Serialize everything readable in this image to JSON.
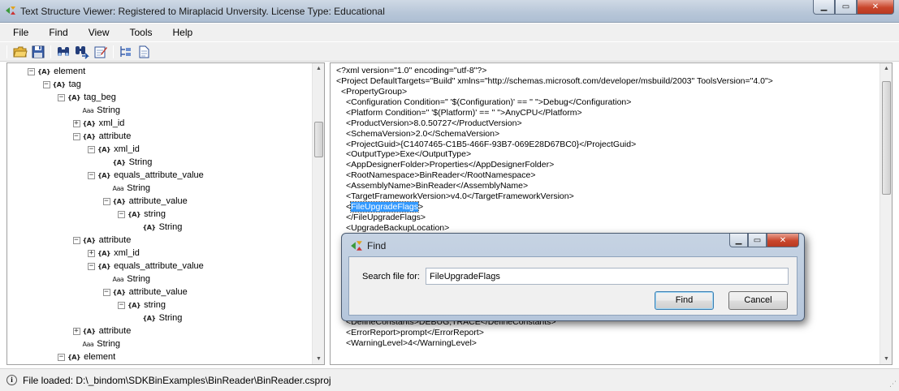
{
  "window": {
    "title": "Text Structure Viewer: Registered to Miraplacid Unversity. License Type: Educational",
    "minimize_glyph": "▁",
    "maximize_glyph": "▭",
    "close_glyph": "✕"
  },
  "menu": [
    "File",
    "Find",
    "View",
    "Tools",
    "Help"
  ],
  "toolbar": {
    "icons": [
      "open-folder-icon",
      "save-icon",
      "find-icon",
      "find-next-icon",
      "edit-icon",
      "tree-view-icon",
      "document-view-icon"
    ]
  },
  "tree": {
    "icon_labels": {
      "element": "{A}",
      "string": "Aaa"
    },
    "nodes": [
      {
        "label": "element",
        "level": 0,
        "toggle": "−",
        "kind": "element"
      },
      {
        "label": "tag",
        "level": 1,
        "toggle": "−",
        "kind": "element"
      },
      {
        "label": "tag_beg",
        "level": 2,
        "toggle": "−",
        "kind": "element"
      },
      {
        "label": "String",
        "level": 3,
        "toggle": "",
        "kind": "string"
      },
      {
        "label": "xml_id",
        "level": 3,
        "toggle": "+",
        "kind": "element"
      },
      {
        "label": "attribute",
        "level": 3,
        "toggle": "−",
        "kind": "element"
      },
      {
        "label": "xml_id",
        "level": 4,
        "toggle": "−",
        "kind": "element"
      },
      {
        "label": "String",
        "level": 5,
        "toggle": "",
        "kind": "element"
      },
      {
        "label": "equals_attribute_value",
        "level": 4,
        "toggle": "−",
        "kind": "element"
      },
      {
        "label": "String",
        "level": 5,
        "toggle": "",
        "kind": "string"
      },
      {
        "label": "attribute_value",
        "level": 5,
        "toggle": "−",
        "kind": "element"
      },
      {
        "label": "string",
        "level": 6,
        "toggle": "−",
        "kind": "element"
      },
      {
        "label": "String",
        "level": 7,
        "toggle": "",
        "kind": "element"
      },
      {
        "label": "attribute",
        "level": 3,
        "toggle": "−",
        "kind": "element"
      },
      {
        "label": "xml_id",
        "level": 4,
        "toggle": "+",
        "kind": "element"
      },
      {
        "label": "equals_attribute_value",
        "level": 4,
        "toggle": "−",
        "kind": "element"
      },
      {
        "label": "String",
        "level": 5,
        "toggle": "",
        "kind": "string"
      },
      {
        "label": "attribute_value",
        "level": 5,
        "toggle": "−",
        "kind": "element"
      },
      {
        "label": "string",
        "level": 6,
        "toggle": "−",
        "kind": "element"
      },
      {
        "label": "String",
        "level": 7,
        "toggle": "",
        "kind": "element"
      },
      {
        "label": "attribute",
        "level": 3,
        "toggle": "+",
        "kind": "element"
      },
      {
        "label": "String",
        "level": 3,
        "toggle": "",
        "kind": "string"
      },
      {
        "label": "element",
        "level": 2,
        "toggle": "−",
        "kind": "element"
      }
    ]
  },
  "xml": {
    "lines": [
      {
        "text": "<?xml version=\"1.0\" encoding=\"utf-8\"?>",
        "indent": 0
      },
      {
        "text": "<Project DefaultTargets=\"Build\" xmlns=\"http://schemas.microsoft.com/developer/msbuild/2003\" ToolsVersion=\"4.0\">",
        "indent": 0
      },
      {
        "text": "<PropertyGroup>",
        "indent": 1
      },
      {
        "text": "<Configuration Condition=\" '$(Configuration)' == '' \">Debug</Configuration>",
        "indent": 2
      },
      {
        "text": "<Platform Condition=\" '$(Platform)' == '' \">AnyCPU</Platform>",
        "indent": 2
      },
      {
        "text": "<ProductVersion>8.0.50727</ProductVersion>",
        "indent": 2
      },
      {
        "text": "<SchemaVersion>2.0</SchemaVersion>",
        "indent": 2
      },
      {
        "text": "<ProjectGuid>{C1407465-C1B5-466F-93B7-069E28D67BC0}</ProjectGuid>",
        "indent": 2
      },
      {
        "text": "<OutputType>Exe</OutputType>",
        "indent": 2
      },
      {
        "text": "<AppDesignerFolder>Properties</AppDesignerFolder>",
        "indent": 2
      },
      {
        "text": "<RootNamespace>BinReader</RootNamespace>",
        "indent": 2
      },
      {
        "text": "<AssemblyName>BinReader</AssemblyName>",
        "indent": 2
      },
      {
        "text": "<TargetFrameworkVersion>v4.0</TargetFrameworkVersion>",
        "indent": 2
      },
      {
        "text": "<",
        "indent": 2,
        "highlight": "FileUpgradeFlags",
        "after": ">"
      },
      {
        "text": "</FileUpgradeFlags>",
        "indent": 2
      },
      {
        "text": "<UpgradeBackupLocation>",
        "indent": 2
      }
    ],
    "lines_bottom": [
      {
        "text": "<DefineConstants>DEBUG;TRACE</DefineConstants>",
        "indent": 2
      },
      {
        "text": "<ErrorReport>prompt</ErrorReport>",
        "indent": 2
      },
      {
        "text": "<WarningLevel>4</WarningLevel>",
        "indent": 2
      }
    ]
  },
  "status": {
    "text": "File loaded: D:\\_bindom\\SDKBinExamples\\BinReader\\BinReader.csproj",
    "info_glyph": "i"
  },
  "find_dialog": {
    "title": "Find",
    "label": "Search file for:",
    "input_value": "FileUpgradeFlags",
    "find_label": "Find",
    "cancel_label": "Cancel"
  }
}
